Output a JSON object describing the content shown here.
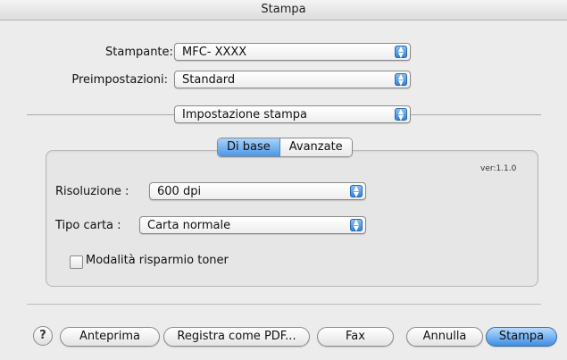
{
  "window": {
    "title": "Stampa"
  },
  "printer": {
    "label": "Stampante:",
    "value": "MFC- XXXX"
  },
  "presets": {
    "label": "Preimpostazioni:",
    "value": "Standard"
  },
  "panel_select": {
    "value": "Impostazione stampa"
  },
  "tabs": [
    {
      "label": "Di base",
      "selected": true
    },
    {
      "label": "Avanzate",
      "selected": false
    }
  ],
  "version": "ver:1.1.0",
  "resolution": {
    "label": "Risoluzione :",
    "value": "600 dpi"
  },
  "paper_type": {
    "label": "Tipo carta :",
    "value": "Carta normale"
  },
  "toner_saving": {
    "label": "Modalità risparmio toner",
    "checked": false
  },
  "buttons": {
    "help": "?",
    "preview": "Anteprima",
    "save_pdf": "Registra come PDF...",
    "fax": "Fax",
    "cancel": "Annulla",
    "print": "Stampa"
  },
  "icons": {
    "popup_arrows": "up-down-arrows-icon",
    "help": "question-mark-icon"
  },
  "colors": {
    "accent": "#4b97e6",
    "window_bg": "#ececec"
  }
}
